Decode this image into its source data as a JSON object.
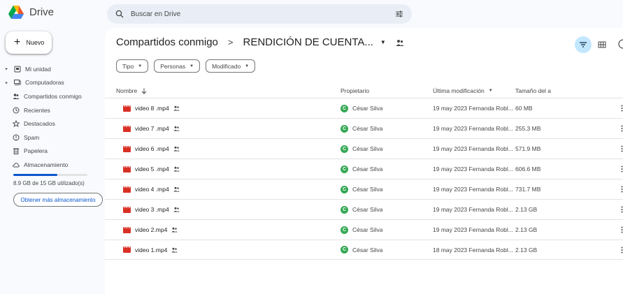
{
  "app": {
    "name": "Drive"
  },
  "search": {
    "placeholder": "Buscar en Drive"
  },
  "sidebar": {
    "new_label": "Nuevo",
    "items": [
      {
        "label": "Mi unidad",
        "icon": "drive-icon"
      },
      {
        "label": "Computadoras",
        "icon": "computer-icon"
      },
      {
        "label": "Compartidos conmigo",
        "icon": "people-icon"
      },
      {
        "label": "Recientes",
        "icon": "clock-icon"
      },
      {
        "label": "Destacados",
        "icon": "star-icon"
      },
      {
        "label": "Spam",
        "icon": "spam-icon"
      },
      {
        "label": "Papelera",
        "icon": "trash-icon"
      },
      {
        "label": "Almacenamiento",
        "icon": "cloud-icon"
      }
    ],
    "storage_used_fraction": 0.593,
    "storage_text": "8.9 GB de 15 GB utilizado(s)",
    "more_storage_label": "Obtener más almacenamiento"
  },
  "breadcrumb": {
    "parent": "Compartidos conmigo",
    "separator": ">",
    "current": "RENDICIÓN DE CUENTA..."
  },
  "filters": [
    {
      "label": "Tipo"
    },
    {
      "label": "Personas"
    },
    {
      "label": "Modificado"
    }
  ],
  "table": {
    "headers": {
      "name": "Nombre",
      "owner": "Propietario",
      "modified": "Última modificación",
      "size": "Tamaño del a"
    },
    "rows": [
      {
        "name": "video 8 .mp4",
        "owner": "César Silva",
        "owner_initial": "C",
        "modified": "19 may 2023 Fernanda Robl...",
        "size": "60 MB"
      },
      {
        "name": "video 7 .mp4",
        "owner": "César Silva",
        "owner_initial": "C",
        "modified": "19 may 2023 Fernanda Robl...",
        "size": "255.3 MB"
      },
      {
        "name": "video 6 .mp4",
        "owner": "César Silva",
        "owner_initial": "C",
        "modified": "19 may 2023 Fernanda Robl...",
        "size": "571.9 MB"
      },
      {
        "name": "video 5 .mp4",
        "owner": "César Silva",
        "owner_initial": "C",
        "modified": "19 may 2023 Fernanda Robl...",
        "size": "606.6 MB"
      },
      {
        "name": "video 4 .mp4",
        "owner": "César Silva",
        "owner_initial": "C",
        "modified": "19 may 2023 Fernanda Robl...",
        "size": "731.7 MB"
      },
      {
        "name": "video 3 .mp4",
        "owner": "César Silva",
        "owner_initial": "C",
        "modified": "19 may 2023 Fernanda Robl...",
        "size": "2.13 GB"
      },
      {
        "name": "video 2.mp4",
        "owner": "César Silva",
        "owner_initial": "C",
        "modified": "19 may 2023 Fernanda Robl...",
        "size": "2.13 GB"
      },
      {
        "name": "video 1.mp4",
        "owner": "César Silva",
        "owner_initial": "C",
        "modified": "18 may 2023 Fernanda Robl...",
        "size": "2.13 GB"
      }
    ]
  },
  "colors": {
    "accent": "#0b57d0",
    "video_red": "#d93025",
    "avatar_green": "#34a853",
    "selected_view": "#c2e7ff"
  }
}
